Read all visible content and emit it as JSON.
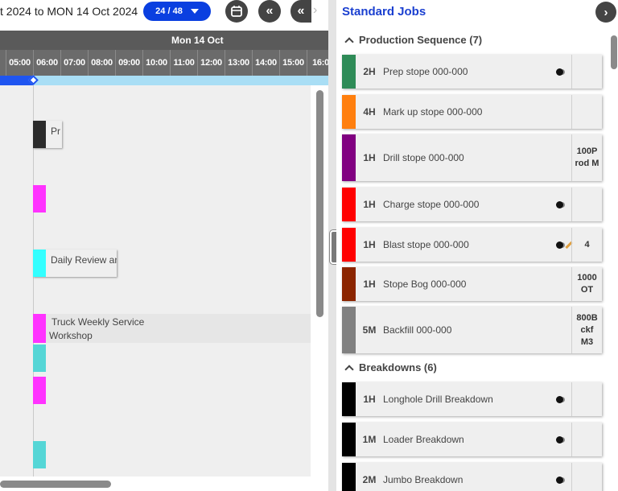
{
  "schedule": {
    "date_range": "t 2024 to MON 14 Oct 2024",
    "period_label": "24 / 48",
    "day_label": "Mon 14 Oct",
    "hours": [
      "0",
      "05:00",
      "06:00",
      "07:00",
      "08:00",
      "09:00",
      "10:00",
      "11:00",
      "12:00",
      "13:00",
      "14:00",
      "15:00",
      "16:0"
    ],
    "tasks": [
      {
        "label": "Pr",
        "color": "#2b2b2b"
      },
      {
        "label": "",
        "color": "#ff33ff"
      },
      {
        "label": "Daily Review an",
        "color": "#33ffff"
      },
      {
        "line1": "Truck Weekly Service",
        "line2": "Workshop",
        "color": "#ff33ff"
      },
      {
        "label": "",
        "color": "#55d6d6"
      },
      {
        "label": "",
        "color": "#ff33ff"
      },
      {
        "label": "",
        "color": "#55d6d6"
      }
    ]
  },
  "panel": {
    "title": "Standard Jobs",
    "sections": [
      {
        "title": "Production Sequence (7)",
        "jobs": [
          {
            "duration": "2H",
            "name": "Prep stope 000-000",
            "color": "#2e8b57",
            "indicator": true,
            "extra": ""
          },
          {
            "duration": "4H",
            "name": "Mark up stope 000-000",
            "color": "#ff7f0e",
            "indicator": false,
            "extra": ""
          },
          {
            "duration": "1H",
            "name": "Drill stope 000-000",
            "color": "#800080",
            "indicator": false,
            "extra": "100P rod M"
          },
          {
            "duration": "1H",
            "name": "Charge stope 000-000",
            "color": "#ff0000",
            "indicator": true,
            "extra": ""
          },
          {
            "duration": "1H",
            "name": "Blast stope 000-000",
            "color": "#ff0000",
            "indicator": true,
            "pencil": true,
            "extra": "4"
          },
          {
            "duration": "1H",
            "name": "Stope Bog 000-000",
            "color": "#8b2500",
            "indicator": false,
            "extra": "1000 OT"
          },
          {
            "duration": "5M",
            "name": "Backfill 000-000",
            "color": "#808080",
            "indicator": false,
            "extra": "800B ckf M3"
          }
        ]
      },
      {
        "title": "Breakdowns (6)",
        "jobs": [
          {
            "duration": "1H",
            "name": "Longhole Drill Breakdown",
            "color": "#000000",
            "indicator": true,
            "extra": ""
          },
          {
            "duration": "1M",
            "name": "Loader Breakdown",
            "color": "#000000",
            "indicator": true,
            "extra": ""
          },
          {
            "duration": "2M",
            "name": "Jumbo Breakdown",
            "color": "#000000",
            "indicator": true,
            "extra": ""
          }
        ]
      }
    ]
  },
  "icons": {
    "calendar": "calendar-icon",
    "rewind": "double-chevron-left-icon",
    "next": "chevron-right-icon"
  }
}
